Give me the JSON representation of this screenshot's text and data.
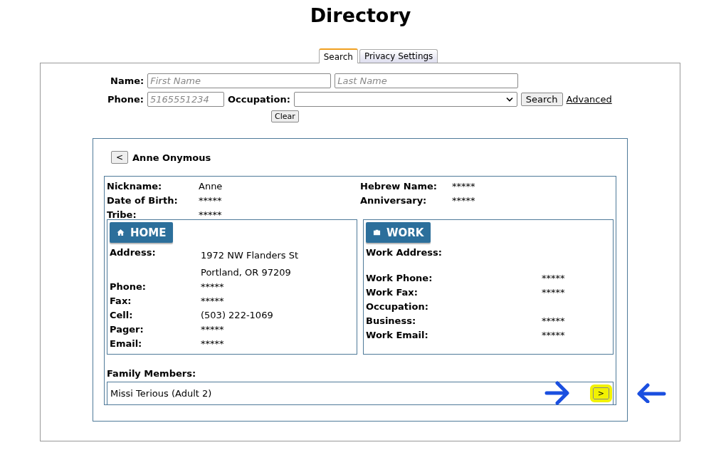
{
  "page": {
    "title": "Directory"
  },
  "tabs": [
    {
      "label": "Search",
      "selected": true
    },
    {
      "label": "Privacy Settings",
      "selected": false
    }
  ],
  "search_form": {
    "name_label": "Name:",
    "first_name": {
      "placeholder": "First Name"
    },
    "last_name": {
      "placeholder": "Last Name"
    },
    "phone_label": "Phone:",
    "phone": {
      "placeholder": "5165551234"
    },
    "occupation_label": "Occupation:",
    "search_button": "Search",
    "advanced_link": "Advanced",
    "clear_button": "Clear"
  },
  "profile": {
    "back_button": "<",
    "name": "Anne Onymous",
    "left_fields": [
      {
        "label": "Nickname:",
        "value": "Anne"
      },
      {
        "label": "Date of Birth:",
        "value": "*****"
      },
      {
        "label": "Tribe:",
        "value": "*****"
      }
    ],
    "right_fields": [
      {
        "label": "Hebrew Name:",
        "value": "*****"
      },
      {
        "label": "Anniversary:",
        "value": "*****"
      }
    ],
    "home": {
      "heading": "HOME",
      "fields": [
        {
          "label": "Address:",
          "values": [
            "1972 NW Flanders St",
            "Portland, OR 97209"
          ]
        },
        {
          "label": "Phone:",
          "values": [
            "*****"
          ]
        },
        {
          "label": "Fax:",
          "values": [
            "*****"
          ]
        },
        {
          "label": "Cell:",
          "values": [
            "(503) 222-1069"
          ]
        },
        {
          "label": "Pager:",
          "values": [
            "*****"
          ]
        },
        {
          "label": "Email:",
          "values": [
            "*****"
          ]
        }
      ]
    },
    "work": {
      "heading": "WORK",
      "fields": [
        {
          "label": "Work Address:"
        },
        {
          "label": "Work Phone:",
          "values": [
            "*****"
          ]
        },
        {
          "label": "Work Fax:",
          "values": [
            "*****"
          ]
        },
        {
          "label": "Occupation:"
        },
        {
          "label": "Business:",
          "values": [
            "*****"
          ]
        },
        {
          "label": "Work Email:",
          "values": [
            "*****"
          ]
        }
      ]
    },
    "family_label": "Family Members:",
    "family_members": [
      {
        "name": "Missi Terious (Adult 2)",
        "button": ">",
        "highlighted": true
      }
    ]
  }
}
